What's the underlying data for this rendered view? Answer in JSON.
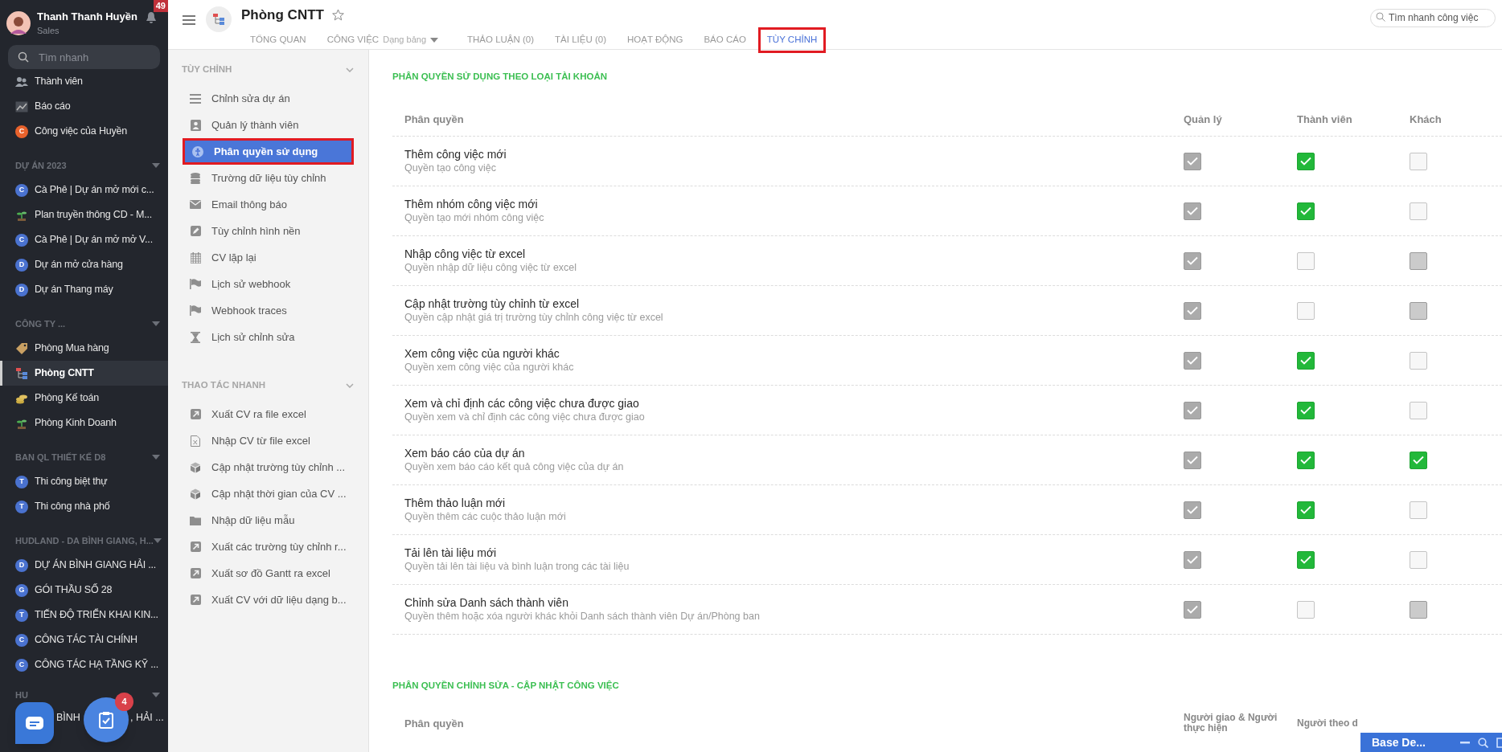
{
  "user": {
    "name": "Thanh Thanh Huyền",
    "role": "Sales",
    "notifications": "49"
  },
  "sidebar_search": {
    "placeholder": "Tìm nhanh"
  },
  "sidebar_top": [
    {
      "kind": "users",
      "label": "Thành viên",
      "selected": false
    },
    {
      "kind": "chart",
      "label": "Báo cáo",
      "selected": false
    },
    {
      "kind": "letter",
      "letter": "C",
      "color": "#e8622c",
      "label": "Công việc của Huyền",
      "selected": false
    }
  ],
  "sidebar_sections": [
    {
      "title": "DỰ ÁN 2023",
      "items": [
        {
          "kind": "letter",
          "letter": "C",
          "color": "#4a72cf",
          "label": "Cà Phê | Dự án mở mới c...",
          "selected": false
        },
        {
          "kind": "plant",
          "label": "Plan truyền thông CD - M...",
          "selected": false
        },
        {
          "kind": "letter",
          "letter": "C",
          "color": "#4a72cf",
          "label": "Cà Phê | Dự án mở mở V...",
          "selected": false
        },
        {
          "kind": "letter",
          "letter": "D",
          "color": "#4a72cf",
          "label": "Dự án mở cửa hàng",
          "selected": false
        },
        {
          "kind": "letter",
          "letter": "D",
          "color": "#4a72cf",
          "label": "Dự án Thang máy",
          "selected": false
        }
      ]
    },
    {
      "title": "CÔNG TY ...",
      "items": [
        {
          "kind": "tag",
          "label": "Phòng Mua hàng",
          "selected": false
        },
        {
          "kind": "org",
          "label": "Phòng CNTT",
          "selected": true
        },
        {
          "kind": "coins",
          "label": "Phòng Kế toán",
          "selected": false
        },
        {
          "kind": "plant",
          "label": "Phòng Kinh Doanh",
          "selected": false
        }
      ]
    },
    {
      "title": "BAN QL THIẾT KẾ D8",
      "items": [
        {
          "kind": "letter",
          "letter": "T",
          "color": "#4a72cf",
          "label": "Thi công biệt thự",
          "selected": false
        },
        {
          "kind": "letter",
          "letter": "T",
          "color": "#4a72cf",
          "label": "Thi công nhà phố",
          "selected": false
        }
      ]
    },
    {
      "title": "HUDLAND - DA BÌNH GIANG, H...",
      "items": [
        {
          "kind": "letter",
          "letter": "D",
          "color": "#4a72cf",
          "label": "DỰ ÁN BÌNH GIANG HẢI ...",
          "selected": false
        },
        {
          "kind": "letter",
          "letter": "G",
          "color": "#4a72cf",
          "label": "GÓI THẦU SỐ 28",
          "selected": false
        },
        {
          "kind": "letter",
          "letter": "T",
          "color": "#4a72cf",
          "label": "TIẾN ĐỘ TRIỂN KHAI KIN...",
          "selected": false
        },
        {
          "kind": "letter",
          "letter": "C",
          "color": "#4a72cf",
          "label": "CÔNG TÁC TÀI CHÍNH",
          "selected": false
        },
        {
          "kind": "letter",
          "letter": "C",
          "color": "#4a72cf",
          "label": "CÔNG TÁC HẠ TẦNG KỸ ...",
          "selected": false
        }
      ]
    }
  ],
  "sidebar_partial": {
    "section_title": "HU",
    "item_parts": [
      "BÌNH",
      ", HẢI ..."
    ]
  },
  "floating": {
    "task_badge": "4"
  },
  "header": {
    "title": "Phòng CNTT",
    "tabs": [
      {
        "label": "TỔNG QUAN",
        "selected": false,
        "highlighted": false
      },
      {
        "label": "CÔNG VIỆC",
        "sub": "Dạng bảng",
        "selected": false,
        "highlighted": false
      },
      {
        "label": "THẢO LUẬN (0)",
        "selected": false,
        "highlighted": false
      },
      {
        "label": "TÀI LIỆU (0)",
        "selected": false,
        "highlighted": false
      },
      {
        "label": "HOẠT ĐỘNG",
        "selected": false,
        "highlighted": false
      },
      {
        "label": "BÁO CÁO",
        "selected": false,
        "highlighted": false
      },
      {
        "label": "TÙY CHỈNH",
        "selected": true,
        "highlighted": true
      }
    ],
    "search": {
      "placeholder": "Tìm nhanh công việc"
    }
  },
  "settings_menu": [
    {
      "title": "TÙY CHỈNH",
      "items": [
        {
          "kind": "lines",
          "label": "Chỉnh sửa dự án",
          "selected": false,
          "highlighted": false
        },
        {
          "kind": "card",
          "label": "Quản lý thành viên",
          "selected": false,
          "highlighted": false
        },
        {
          "kind": "person",
          "label": "Phân quyền sử dụng",
          "selected": true,
          "highlighted": true
        },
        {
          "kind": "database",
          "label": "Trường dữ liệu tùy chỉnh",
          "selected": false,
          "highlighted": false
        },
        {
          "kind": "mail",
          "label": "Email thông báo",
          "selected": false,
          "highlighted": false
        },
        {
          "kind": "pencil",
          "label": "Tùy chỉnh hình nền",
          "selected": false,
          "highlighted": false
        },
        {
          "kind": "calendar",
          "label": "CV lặp lại",
          "selected": false,
          "highlighted": false
        },
        {
          "kind": "flag",
          "label": "Lịch sử webhook",
          "selected": false,
          "highlighted": false
        },
        {
          "kind": "flag",
          "label": "Webhook traces",
          "selected": false,
          "highlighted": false
        },
        {
          "kind": "hourglass",
          "label": "Lịch sử chỉnh sửa",
          "selected": false,
          "highlighted": false
        }
      ]
    },
    {
      "title": "THAO TÁC NHANH",
      "items": [
        {
          "kind": "export",
          "label": "Xuất CV ra file excel",
          "selected": false,
          "highlighted": false
        },
        {
          "kind": "file",
          "label": "Nhập CV từ file excel",
          "selected": false,
          "highlighted": false
        },
        {
          "kind": "cube",
          "label": "Cập nhật trường tùy chỉnh ...",
          "selected": false,
          "highlighted": false
        },
        {
          "kind": "cube",
          "label": "Cập nhật thời gian của CV ...",
          "selected": false,
          "highlighted": false
        },
        {
          "kind": "folder",
          "label": "Nhập dữ liệu mẫu",
          "selected": false,
          "highlighted": false
        },
        {
          "kind": "export",
          "label": "Xuất các trường tùy chỉnh r...",
          "selected": false,
          "highlighted": false
        },
        {
          "kind": "export",
          "label": "Xuất sơ đồ Gantt ra excel",
          "selected": false,
          "highlighted": false
        },
        {
          "kind": "export",
          "label": "Xuất CV với dữ liệu dạng b...",
          "selected": false,
          "highlighted": false
        }
      ]
    }
  ],
  "permissions": {
    "title": "PHÂN QUYỀN SỬ DỤNG THEO LOẠI TÀI KHOẢN",
    "columns": [
      "Phân quyền",
      "Quản lý",
      "Thành viên",
      "Khách"
    ],
    "rows": [
      {
        "title": "Thêm công việc mới",
        "description": "Quyền tạo công việc",
        "cells": [
          {
            "checked": true,
            "disabled": true
          },
          {
            "checked": true,
            "disabled": false
          },
          {
            "checked": false,
            "disabled": false
          }
        ]
      },
      {
        "title": "Thêm nhóm công việc mới",
        "description": "Quyền tạo mới nhóm công việc",
        "cells": [
          {
            "checked": true,
            "disabled": true
          },
          {
            "checked": true,
            "disabled": false
          },
          {
            "checked": false,
            "disabled": false
          }
        ]
      },
      {
        "title": "Nhập công việc từ excel",
        "description": "Quyền nhập dữ liệu công việc từ excel",
        "cells": [
          {
            "checked": true,
            "disabled": true
          },
          {
            "checked": false,
            "disabled": false
          },
          {
            "checked": false,
            "disabled": true
          }
        ]
      },
      {
        "title": "Cập nhật trường tùy chỉnh từ excel",
        "description": "Quyền cập nhật giá trị trường tùy chỉnh công việc từ excel",
        "cells": [
          {
            "checked": true,
            "disabled": true
          },
          {
            "checked": false,
            "disabled": false
          },
          {
            "checked": false,
            "disabled": true
          }
        ]
      },
      {
        "title": "Xem công việc của người khác",
        "description": "Quyền xem công việc của người khác",
        "cells": [
          {
            "checked": true,
            "disabled": true
          },
          {
            "checked": true,
            "disabled": false
          },
          {
            "checked": false,
            "disabled": false
          }
        ]
      },
      {
        "title": "Xem và chỉ định các công việc chưa được giao",
        "description": "Quyền xem và chỉ định các công việc chưa được giao",
        "cells": [
          {
            "checked": true,
            "disabled": true
          },
          {
            "checked": true,
            "disabled": false
          },
          {
            "checked": false,
            "disabled": false
          }
        ]
      },
      {
        "title": "Xem báo cáo của dự án",
        "description": "Quyền xem báo cáo kết quả công việc của dự án",
        "cells": [
          {
            "checked": true,
            "disabled": true
          },
          {
            "checked": true,
            "disabled": false
          },
          {
            "checked": true,
            "disabled": false
          }
        ]
      },
      {
        "title": "Thêm thảo luận mới",
        "description": "Quyền thêm các cuộc thảo luận mới",
        "cells": [
          {
            "checked": true,
            "disabled": true
          },
          {
            "checked": true,
            "disabled": false
          },
          {
            "checked": false,
            "disabled": false
          }
        ]
      },
      {
        "title": "Tải lên tài liệu mới",
        "description": "Quyền tải lên tài liệu và bình luận trong các tài liệu",
        "cells": [
          {
            "checked": true,
            "disabled": true
          },
          {
            "checked": true,
            "disabled": false
          },
          {
            "checked": false,
            "disabled": false
          }
        ]
      },
      {
        "title": "Chỉnh sửa Danh sách thành viên",
        "description": "Quyền thêm hoặc xóa người khác khỏi Danh sách thành viên Dự án/Phòng ban",
        "cells": [
          {
            "checked": true,
            "disabled": true
          },
          {
            "checked": false,
            "disabled": false
          },
          {
            "checked": false,
            "disabled": true
          }
        ]
      }
    ]
  },
  "edit_permissions": {
    "title": "PHÂN QUYỀN CHỈNH SỬA - CẬP NHẬT CÔNG VIỆC",
    "columns": [
      "Phân quyền",
      "Người giao & Người thực hiện",
      "Người theo d"
    ]
  },
  "chat_bar": {
    "title": "Base De..."
  }
}
